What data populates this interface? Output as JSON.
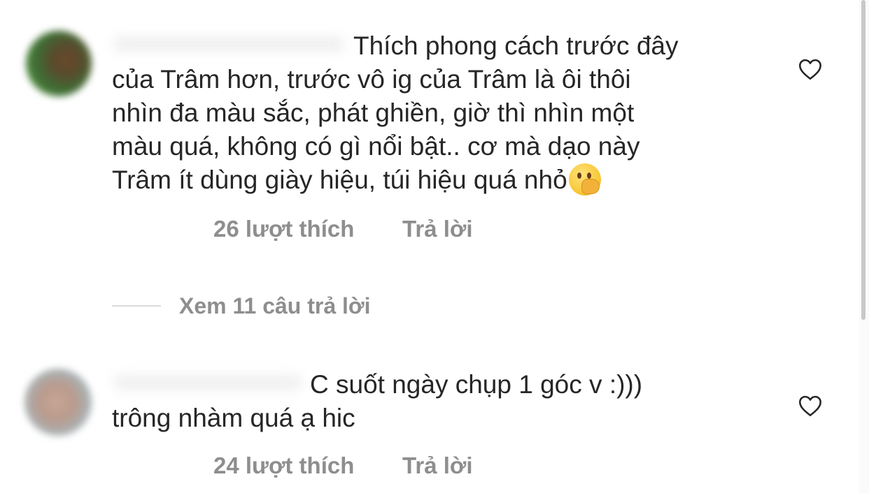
{
  "comments": [
    {
      "text": "Thích phong cách trước đây\ncủa Trâm hơn, trước vô ig của Trâm là ôi thôi\nnhìn đa màu sắc, phát ghiền, giờ thì nhìn một\nmàu quá, không có gì nổi bật.. cơ mà dạo này\nTrâm ít dùng giày hiệu, túi hiệu quá nhỏ",
      "emoji": "face-with-hand-over-mouth",
      "likes": "26 lượt thích",
      "reply": "Trả lời"
    },
    {
      "text": "C suốt ngày chụp 1 góc v :)))\ntrông nhàm quá ạ hic",
      "likes": "24 lượt thích",
      "reply": "Trả lời"
    }
  ],
  "view_replies": "Xem 11 câu trả lời",
  "icons": {
    "like": "heart-outline-icon"
  },
  "colors": {
    "text": "#262626",
    "secondary": "#8e8e8e",
    "divider": "#dbdbdb",
    "background": "#ffffff"
  }
}
